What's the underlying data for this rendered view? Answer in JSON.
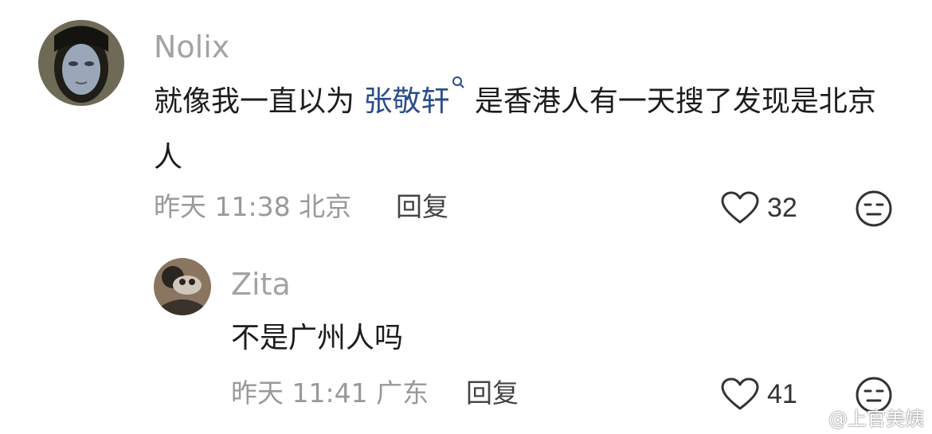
{
  "comments": [
    {
      "username": "Nolix",
      "text_before": "就像我一直以为 ",
      "highlight": "张敬轩",
      "text_after": " 是香港人有一天搜了发现是北京人",
      "time": "昨天 11:38",
      "location": "北京",
      "reply_label": "回复",
      "likes": "32"
    }
  ],
  "replies": [
    {
      "username": "Zita",
      "text": "不是广州人吗",
      "time": "昨天 11:41",
      "location": "广东",
      "reply_label": "回复",
      "likes": "41"
    }
  ],
  "watermark": "@上官美姨",
  "icons": {
    "like": "heart-outline-icon",
    "emoji": "neutral-face-icon",
    "search": "search-icon",
    "weibo": "weibo-logo-icon"
  },
  "colors": {
    "username": "#a3a3a3",
    "highlight": "#2a4d8a",
    "meta": "#999999",
    "text": "#1c1c1c"
  }
}
